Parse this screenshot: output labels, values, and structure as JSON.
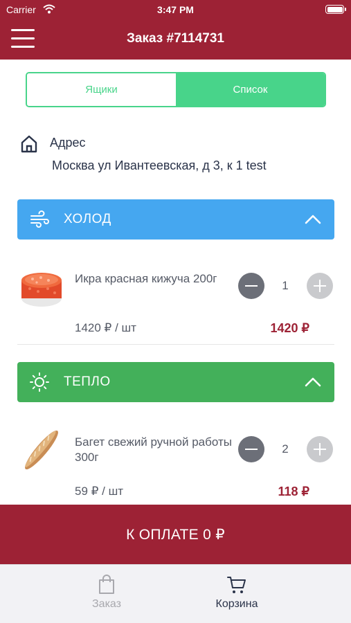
{
  "status_bar": {
    "carrier": "Carrier",
    "time": "3:47 PM"
  },
  "nav": {
    "title": "Заказ #7114731"
  },
  "segments": {
    "boxes": "Ящики",
    "list": "Список"
  },
  "address": {
    "label": "Адрес",
    "value": "Москва ул Ивантеевская, д 3, к 1 test"
  },
  "sections": [
    {
      "title": "ХОЛОД",
      "icon": "wind-icon",
      "color": "#45a7f0",
      "items": [
        {
          "name": "Икра красная кижуча 200г",
          "quantity": "1",
          "unit_price": "1420 ₽ / шт",
          "total": "1420 ₽",
          "image": "red-caviar-jar"
        }
      ]
    },
    {
      "title": "ТЕПЛО",
      "icon": "sun-icon",
      "color": "#43b05a",
      "items": [
        {
          "name": "Багет свежий ручной работы 300г",
          "quantity": "2",
          "unit_price": "59 ₽ / шт",
          "total": "118 ₽",
          "image": "baguette"
        }
      ]
    }
  ],
  "checkout": {
    "label": "К ОПЛАТЕ 0 ₽"
  },
  "tabs": [
    {
      "label": "Заказ",
      "icon": "bag-icon",
      "active": false
    },
    {
      "label": "Корзина",
      "icon": "cart-icon",
      "active": true
    }
  ],
  "colors": {
    "brand": "#9d2235",
    "accent_green": "#48d48a",
    "cold": "#45a7f0",
    "warm": "#43b05a"
  }
}
